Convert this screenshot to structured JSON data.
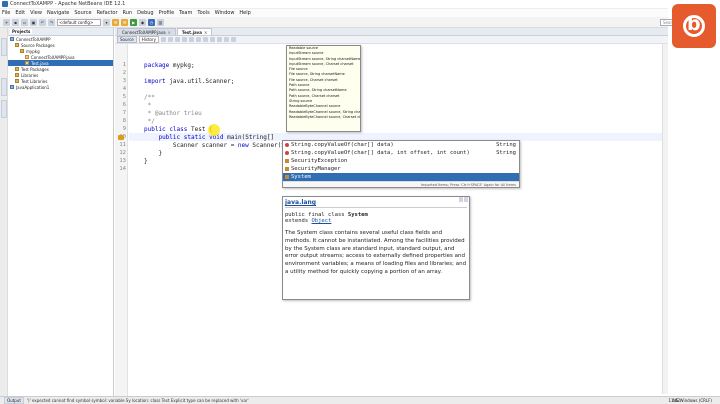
{
  "window": {
    "title": "ConnectToXAMPP - Apache NetBeans IDE 12.1"
  },
  "menu": [
    "File",
    "Edit",
    "View",
    "Navigate",
    "Source",
    "Refactor",
    "Run",
    "Debug",
    "Profile",
    "Team",
    "Tools",
    "Window",
    "Help"
  ],
  "toolbar": {
    "config": "<default config>",
    "search_placeholder": "Search (Ctrl+I)"
  },
  "side_strip": [
    "Navigator",
    "Files",
    "Services"
  ],
  "projects": {
    "tabs": [
      "Projects",
      "Files",
      "Services"
    ],
    "tree": [
      {
        "label": "ConnectToXAMPP",
        "icon": "project-icon",
        "indent": 0
      },
      {
        "label": "Source Packages",
        "icon": "folder-icon",
        "indent": 1
      },
      {
        "label": "mypkg",
        "icon": "package-icon",
        "indent": 2
      },
      {
        "label": "ConnectToXAMPP.java",
        "icon": "java-file-icon",
        "indent": 3
      },
      {
        "label": "Test.java",
        "icon": "java-file-icon",
        "indent": 3,
        "selected": true
      },
      {
        "label": "Test Packages",
        "icon": "folder-icon",
        "indent": 1
      },
      {
        "label": "Libraries",
        "icon": "folder-icon",
        "indent": 1
      },
      {
        "label": "Test Libraries",
        "icon": "folder-icon",
        "indent": 1
      },
      {
        "label": "JavaApplication1",
        "icon": "project-icon",
        "indent": 0
      }
    ]
  },
  "editor": {
    "tabs": [
      {
        "label": "ConnectToXAMPP.java",
        "active": false
      },
      {
        "label": "Test.java",
        "active": true
      }
    ],
    "view_buttons": [
      "Source",
      "History"
    ],
    "lines": [
      {
        "n": "1",
        "text": "package mypkg;"
      },
      {
        "n": "2",
        "text": ""
      },
      {
        "n": "3",
        "text": "import java.util.Scanner;"
      },
      {
        "n": "4",
        "text": ""
      },
      {
        "n": "5",
        "text": "/**"
      },
      {
        "n": "6",
        "text": " *"
      },
      {
        "n": "7",
        "text": " * @author trieu"
      },
      {
        "n": "8",
        "text": " */"
      },
      {
        "n": "9",
        "text": "public class Test {"
      },
      {
        "n": "10",
        "text": "    public static void main(String[] "
      },
      {
        "n": "11",
        "text": "        Scanner scanner = new Scanner(Sy"
      },
      {
        "n": "12",
        "text": "    }"
      },
      {
        "n": "13",
        "text": "}"
      },
      {
        "n": "14",
        "text": ""
      }
    ]
  },
  "param_popup": [
    "Readable source",
    "InputStream source",
    "InputStream source, String charsetName",
    "InputStream source, Charset charset",
    "File source",
    "File source, String charsetName",
    "File source, Charset charset",
    "Path source",
    "Path source, String charsetName",
    "Path source, Charset charset",
    "String source",
    "ReadableByteChannel source",
    "ReadableByteChannel source, String charsetName",
    "ReadableByteChannel source, Charset charset"
  ],
  "completion": {
    "items": [
      {
        "text": "String.copyValueOf(char[] data)",
        "ret": "String",
        "kind": "method"
      },
      {
        "text": "String.copyValueOf(char[] data, int offset, int count)",
        "ret": "String",
        "kind": "method"
      },
      {
        "text": "SecurityException",
        "ret": "",
        "kind": "class"
      },
      {
        "text": "SecurityManager",
        "ret": "",
        "kind": "class"
      },
      {
        "text": "System",
        "ret": "",
        "kind": "class",
        "selected": true
      }
    ],
    "footer": "Imported Items; Press 'Ctrl+SPACE' Again for All Items"
  },
  "javadoc": {
    "package": "java.lang",
    "sig_prefix": "public final class ",
    "sig_name": "System",
    "extends_kw": "extends ",
    "extends_name": "Object",
    "description": "The System class contains several useful class fields and methods. It cannot be instantiated. Among the facilities provided by the System class are standard input, standard output, and error output streams; access to externally defined properties and environment variables; a means of loading files and libraries; and a utility method for quickly copying a portion of an array."
  },
  "status": {
    "output_tab": "Output",
    "message": "')' expected  cannot find symbol  symbol: variable Sy  location: class Test  Explicit type can be replaced with 'var'",
    "position": "11:42",
    "mode": "INS  Windows (CRLF)"
  },
  "colors": {
    "logo": "#e65b2d",
    "selection": "#2f6db5",
    "keyword": "#0000cc"
  }
}
